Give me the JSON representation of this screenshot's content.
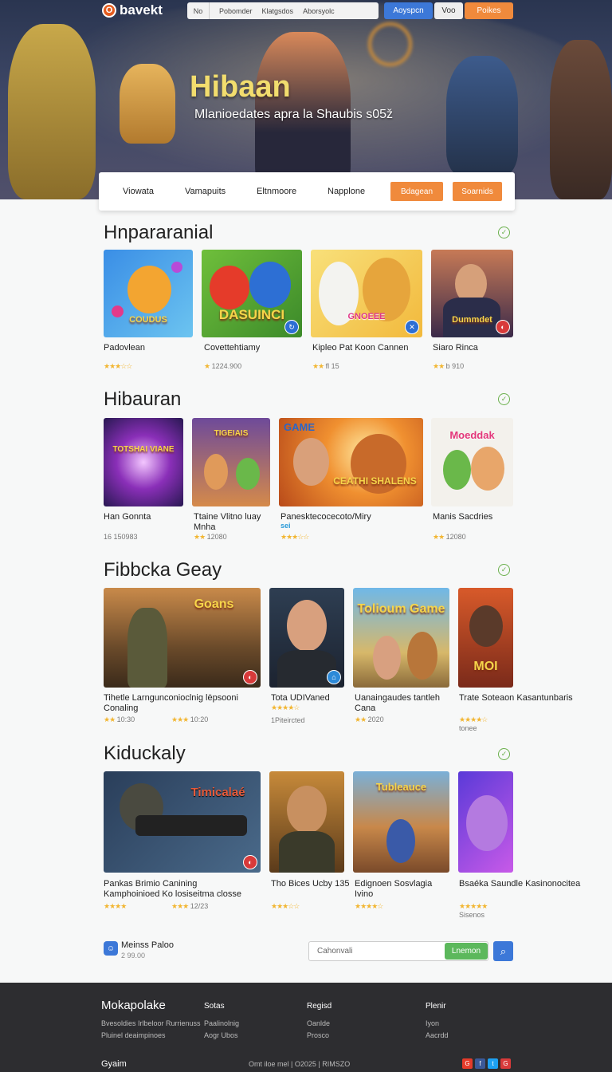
{
  "header": {
    "logo_mark": "O",
    "logo_text": "bavekt",
    "nav": [
      "No",
      "Pobomder",
      "Klatgsdos",
      "Aborsyolc"
    ],
    "btn_blue": "Aoyspcn",
    "btn_plain": "Voo",
    "btn_orange": "Poikes"
  },
  "hero": {
    "title": "Hibaan",
    "subtitle": "Mlanioedates apra la Shaubis s05ž"
  },
  "filters": {
    "items": [
      "Viowata",
      "Vamapuits",
      "Eltnmoore",
      "Napplone"
    ],
    "btn1": "Bdagean",
    "btn2": "Soarnids"
  },
  "sections": [
    {
      "title": "Hnpararanial",
      "cards": [
        {
          "name": "Padovlean",
          "meta": "",
          "stars": "★★★☆☆",
          "art": "COUDUS"
        },
        {
          "name": "Covettehtiamy",
          "meta": "1224.900",
          "stars": "★",
          "art": "DASUINCI"
        },
        {
          "name": "Kipleo Pat Koon Cannen",
          "meta": "fl 15",
          "stars": "★★",
          "art": "GNOEEE"
        },
        {
          "name": "Siaro Rinca",
          "meta": "b 910",
          "stars": "★★",
          "art": "Dummdet"
        }
      ]
    },
    {
      "title": "Hibauran",
      "cards": [
        {
          "name": "Han Gonnta",
          "meta": "16 150983",
          "stars": "",
          "art": "TOTSHAI VIANE"
        },
        {
          "name": "Ttaine Vlitno luay Mnha",
          "meta": "12080",
          "stars": "★★",
          "art": "TIGEIAIS"
        },
        {
          "name": "Panesktecocecoto/Miry",
          "meta": "",
          "stars": "★★★☆☆",
          "tag": "sei",
          "art": "CEATHI SHALENS",
          "badge": "GAME"
        },
        {
          "name": "Manis Sacdries",
          "meta": "12080",
          "stars": "★★",
          "art": "Moeddak"
        }
      ]
    },
    {
      "title": "Fibbcka Geay",
      "cards": [
        {
          "name": "Tihetle Larngunconioclnig lëpsooni Conaling",
          "meta": "10:30",
          "stars": "★★",
          "meta2": "10:20",
          "stars2": "★★★",
          "art": "Goans"
        },
        {
          "name": "Tota UDIVaned",
          "meta": "1Piteircted",
          "stars": "★★★★☆",
          "art": ""
        },
        {
          "name": "Uanaingaudes tantleh Cana",
          "meta": "2020",
          "stars": "★★",
          "art": "Tolioum Game"
        },
        {
          "name": "Trate Soteaon Kasantunbaris",
          "meta": "tonee",
          "stars": "★★★★☆",
          "art": "MOI"
        }
      ]
    },
    {
      "title": "Kiduckaly",
      "cards": [
        {
          "name": "Pankas Brimio Canining Kamphoinioed Ko losiseitma closse",
          "meta": "",
          "stars": "★★★★",
          "meta2": "12/23",
          "stars2": "★★★",
          "art": "Timicalaé"
        },
        {
          "name": "Tho Bices Ucby 135",
          "meta": "",
          "stars": "★★★☆☆",
          "art": ""
        },
        {
          "name": "Edignoen Sosvlagia Ivino",
          "meta": "",
          "stars": "★★★★☆",
          "art": "Tubleauce"
        },
        {
          "name": "Bsaéka Saundle Kasinonocitea",
          "meta": "Sisenos",
          "stars": "★★★★★",
          "art": ""
        }
      ]
    }
  ],
  "bottom": {
    "chat_title": "Meinss Paloo",
    "chat_sub": "2 99.00",
    "search_placeholder": "Cahonvali",
    "search_btn": "Lnemon"
  },
  "footer": {
    "brand": "Mokapolake",
    "col1": [
      "Bvesoldies Irlbeloor Rurrienuss",
      "Pluinel deaimpinoes"
    ],
    "col2_h": "Sotas",
    "col2": [
      "Paalinolnig",
      "Aogr Ubos"
    ],
    "col3_h": "Regisd",
    "col3": [
      "Oanlde",
      "Prosco"
    ],
    "col4_h": "Plenir",
    "col4": [
      "Iyon",
      "Aacrdd"
    ],
    "bottom_brand": "Gyaim",
    "copyright": "Omt iloe mel  |  O2025  |  RIMSZO",
    "social": [
      "G",
      "f",
      "t",
      "G"
    ]
  }
}
